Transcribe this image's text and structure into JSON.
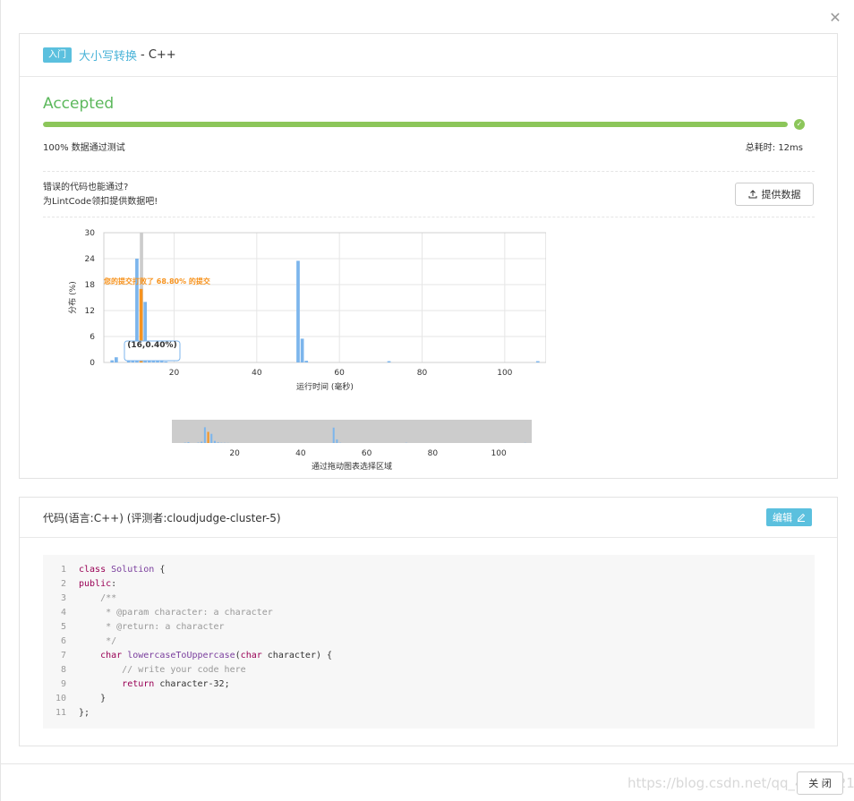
{
  "header": {
    "tag": "入门",
    "problem_title": "大小写转换",
    "language_suffix": "- C++"
  },
  "result": {
    "status": "Accepted",
    "progress_percent": 100,
    "pass_text": "100%  数据通过测试",
    "time_text": "总耗时: 12ms"
  },
  "hint": {
    "line1": "错误的代码也能通过?",
    "line2": "为LintCode领扣提供数据吧!",
    "provide_button": "提供数据"
  },
  "chart_data": {
    "type": "bar",
    "xlabel": "运行时间 (毫秒)",
    "ylabel": "分布 (%)",
    "ylim": [
      0,
      30
    ],
    "yticks": [
      0,
      6,
      12,
      18,
      24,
      30
    ],
    "xlim": [
      3,
      110
    ],
    "xticks": [
      20,
      40,
      60,
      80,
      100
    ],
    "annotation": "您的提交打败了 68.80% 的提交",
    "tooltip": "(16,0.40%)",
    "highlight_x": 12,
    "grid": true,
    "navigator_label": "通过拖动图表选择区域",
    "navigator_xticks": [
      20,
      40,
      60,
      80,
      100
    ],
    "bars": [
      {
        "x": 5,
        "y": 0.5
      },
      {
        "x": 6,
        "y": 1.2
      },
      {
        "x": 9,
        "y": 0.6
      },
      {
        "x": 10,
        "y": 2.0
      },
      {
        "x": 11,
        "y": 24.0
      },
      {
        "x": 12,
        "y": 17.0
      },
      {
        "x": 13,
        "y": 14.0
      },
      {
        "x": 14,
        "y": 3.2
      },
      {
        "x": 15,
        "y": 1.0
      },
      {
        "x": 16,
        "y": 0.4
      },
      {
        "x": 17,
        "y": 0.3
      },
      {
        "x": 18,
        "y": 0.2
      },
      {
        "x": 50,
        "y": 23.5
      },
      {
        "x": 51,
        "y": 5.5
      },
      {
        "x": 52,
        "y": 0.4
      },
      {
        "x": 72,
        "y": 0.3
      },
      {
        "x": 108,
        "y": 0.3
      }
    ],
    "colors": {
      "bar": "#7cb5ec",
      "highlight": "#f7931e",
      "annotation": "#f7931e",
      "crosshair": "#cccccc"
    }
  },
  "code_panel": {
    "title": "代码(语言:C++) (评测者:cloudjudge-cluster-5)",
    "edit_button": "编辑",
    "lines": [
      {
        "n": "1",
        "code": "class Solution {"
      },
      {
        "n": "2",
        "code": "public:"
      },
      {
        "n": "3",
        "code": "    /**"
      },
      {
        "n": "4",
        "code": "     * @param character: a character"
      },
      {
        "n": "5",
        "code": "     * @return: a character"
      },
      {
        "n": "6",
        "code": "     */"
      },
      {
        "n": "7",
        "code": "    char lowercaseToUppercase(char character) {"
      },
      {
        "n": "8",
        "code": "        // write your code here"
      },
      {
        "n": "9",
        "code": "        return character-32;"
      },
      {
        "n": "10",
        "code": "    }"
      },
      {
        "n": "11",
        "code": "};"
      }
    ]
  },
  "footer": {
    "close_button": "关 闭",
    "watermark": "https://blog.csdn.net/qq_42498215"
  },
  "icons": {
    "close": "close-icon",
    "check": "check-circle-icon",
    "upload": "upload-icon",
    "edit": "pencil-icon"
  }
}
